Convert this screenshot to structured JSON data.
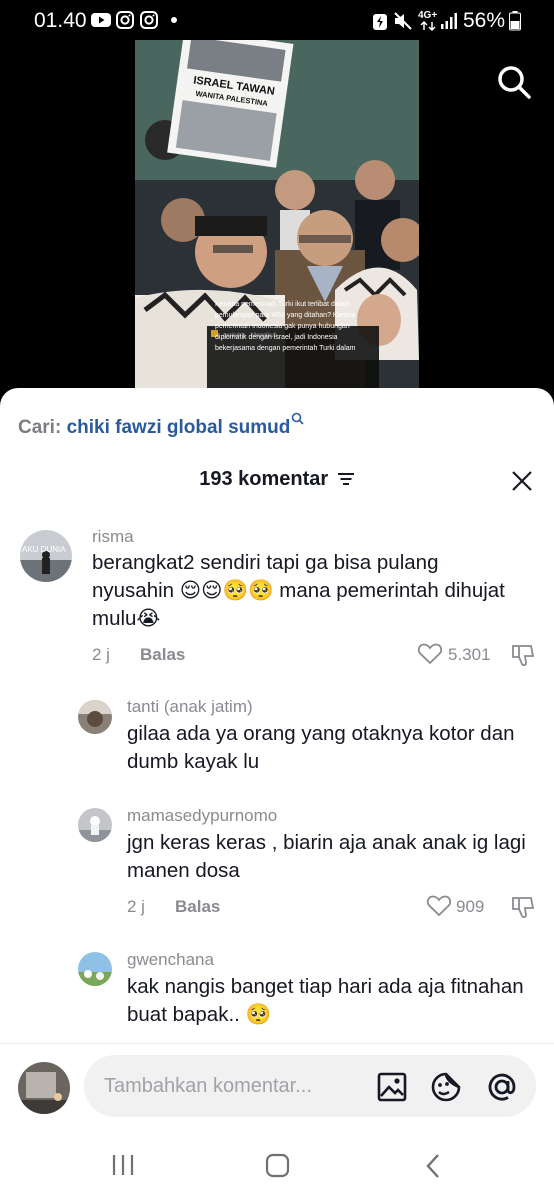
{
  "status_bar": {
    "time": "01.40",
    "network": "4G+",
    "battery": "56%"
  },
  "video": {
    "sign_line1": "ISRAEL TAWAN",
    "sign_line2": "WANITA PALESTINA",
    "caption_account": "gerindra",
    "caption_follow": "Mengikuti",
    "caption_text": "Kenapa pemerintah Turki ikut terlibat dalam pemulangan para WNI yang ditahan? Karena pemerintah Indonesia gak punya hubungan diplomatik dengan israel, jadi Indonesia bekerjasama dengan pemerintah Turki dalam"
  },
  "search": {
    "prefix": "Cari:",
    "query": "chiki fawzi global sumud"
  },
  "header": {
    "title": "193 komentar"
  },
  "comments": [
    {
      "username": "risma",
      "text": "berangkat2 sendiri tapi ga bisa pulang nyusahin 😌😌🥺🥺 mana pemerintah dihujat mulu😭",
      "time": "2 j",
      "reply": "Balas",
      "likes": "5.301"
    },
    {
      "username": "tanti (anak jatim)",
      "text": "gilaa ada ya orang yang otaknya kotor dan dumb kayak lu"
    },
    {
      "username": "mamasedypurnomo",
      "text": "jgn keras keras , biarin aja anak anak ig lagi manen dosa",
      "time": "2 j",
      "reply": "Balas",
      "likes": "909"
    },
    {
      "username": "gwenchana",
      "text": "kak nangis banget tiap hari ada aja fitnahan buat bapak.. 🥺"
    }
  ],
  "input": {
    "placeholder": "Tambahkan komentar..."
  },
  "icons": {
    "search": "search-icon",
    "sort": "sort-icon",
    "close": "close-icon",
    "heart": "heart-icon",
    "dislike": "dislike-icon",
    "image": "image-icon",
    "emoji": "emoji-icon",
    "mention": "mention-icon"
  }
}
